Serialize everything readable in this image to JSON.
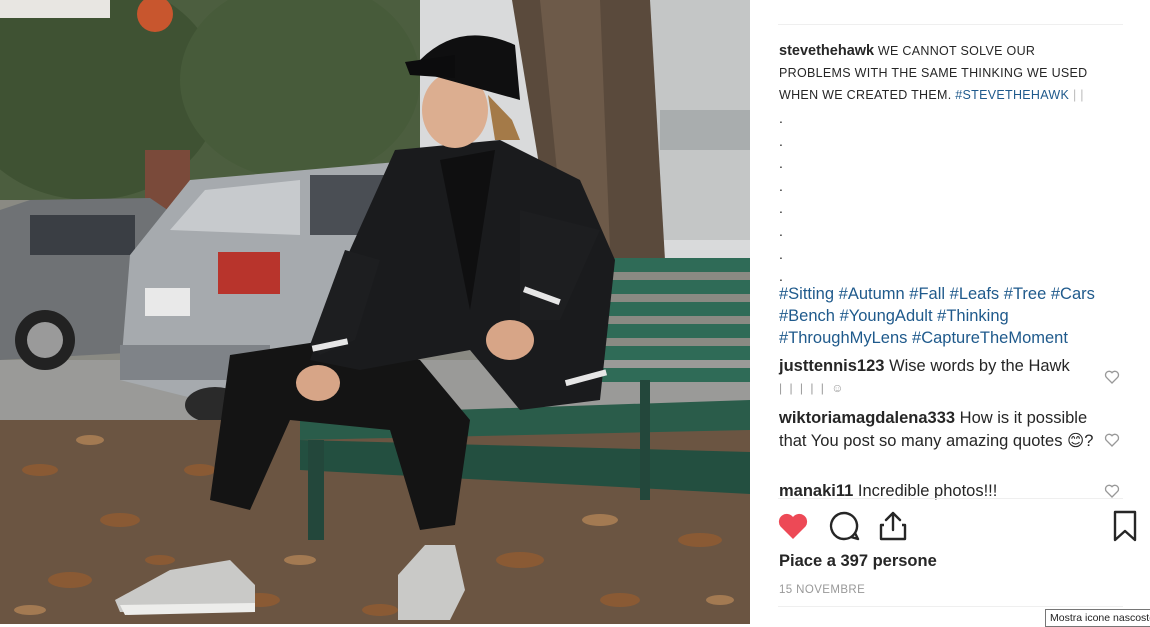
{
  "post": {
    "username": "stevethehawk",
    "caption_text": "WE CANNOT SOLVE OUR PROBLEMS WITH THE SAME THINKING WE USED WHEN WE CREATED THEM.",
    "caption_tag": "#STEVETHEHAWK",
    "caption_tail": "| |",
    "dots": [
      ".",
      ".",
      ".",
      ".",
      ".",
      ".",
      ".",
      "."
    ],
    "hashtags": [
      "#Sitting",
      "#Autumn",
      "#Fall",
      "#Leafs",
      "#Tree",
      "#Cars",
      "#Bench",
      "#YoungAdult",
      "#Thinking",
      "#ThroughMyLens",
      "#CaptureTheMoment"
    ]
  },
  "comments": [
    {
      "user": "justtennis123",
      "text": "Wise words by the Hawk",
      "sub": "| | | | | ☺"
    },
    {
      "user": "wiktoriamagdalena333",
      "text": "How is it possible that You post so many amazing quotes 😊?"
    },
    {
      "user": "manaki11",
      "text": "Incredible photos!!!"
    }
  ],
  "actions": {
    "like_icon": "heart-filled-icon",
    "comment_icon": "comment-bubble-icon",
    "share_icon": "share-icon",
    "save_icon": "bookmark-icon",
    "like_color": "#ed4956"
  },
  "likes_text": "Piace a 397 persone",
  "date_text": "15 NOVEMBRE",
  "tooltip_text": "Mostra icone nascoste"
}
